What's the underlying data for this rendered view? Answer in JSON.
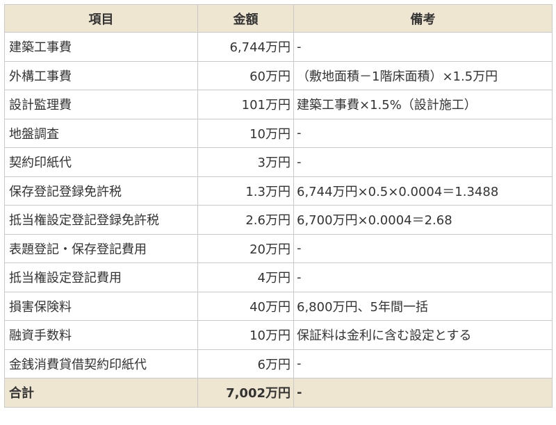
{
  "table": {
    "headers": [
      "項目",
      "金額",
      "備考"
    ],
    "rows": [
      {
        "item": "建築工事費",
        "amount": "6,744万円",
        "note": "-"
      },
      {
        "item": "外構工事費",
        "amount": "60万円",
        "note": "（敷地面積－1階床面積）×1.5万円"
      },
      {
        "item": "設計監理費",
        "amount": "101万円",
        "note": "建築工事費×1.5%（設計施工）"
      },
      {
        "item": "地盤調査",
        "amount": "10万円",
        "note": "-"
      },
      {
        "item": "契約印紙代",
        "amount": "3万円",
        "note": "-"
      },
      {
        "item": "保存登記登録免許税",
        "amount": "1.3万円",
        "note": "6,744万円×0.5×0.0004＝1.3488"
      },
      {
        "item": "抵当権設定登記登録免許税",
        "amount": "2.6万円",
        "note": "6,700万円×0.0004＝2.68"
      },
      {
        "item": "表題登記・保存登記費用",
        "amount": "20万円",
        "note": "-"
      },
      {
        "item": "抵当権設定登記費用",
        "amount": "4万円",
        "note": "-"
      },
      {
        "item": "損害保険料",
        "amount": "40万円",
        "note": "6,800万円、5年間一括"
      },
      {
        "item": "融資手数料",
        "amount": "10万円",
        "note": "保証料は金利に含む設定とする"
      },
      {
        "item": "金銭消費貸借契約印紙代",
        "amount": "6万円",
        "note": "-"
      }
    ],
    "total": {
      "item": "合計",
      "amount": "7,002万円",
      "note": "-"
    }
  },
  "colors": {
    "header_bg": "#efe6d2",
    "border": "#c9c9c9",
    "text": "#333333"
  }
}
